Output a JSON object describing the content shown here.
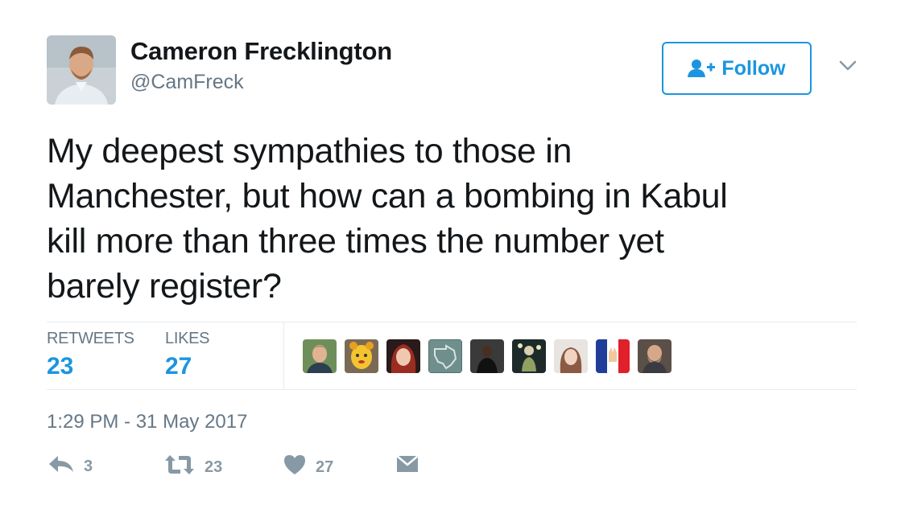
{
  "author": {
    "name": "Cameron Frecklington",
    "handle": "@CamFreck"
  },
  "follow_button": {
    "label": "Follow"
  },
  "tweet": {
    "lines": [
      "My deepest sympathies to those in",
      "Manchester, but how can a bombing in Kabul",
      "kill more than three times the number yet",
      "barely register?"
    ],
    "timestamp": "1:29 PM - 31 May 2017"
  },
  "stats": {
    "retweets_label": "RETWEETS",
    "retweets": "23",
    "likes_label": "LIKES",
    "likes": "27"
  },
  "actions": {
    "reply_count": "3",
    "retweet_count": "23",
    "like_count": "27"
  },
  "colors": {
    "accent": "#1b95e0",
    "muted": "#657786",
    "icon": "#8899a6"
  },
  "icons": {
    "follow": "add-user-icon",
    "caret": "chevron-down-icon",
    "reply": "reply-icon",
    "retweet": "retweet-icon",
    "like": "heart-icon",
    "dm": "envelope-icon"
  }
}
